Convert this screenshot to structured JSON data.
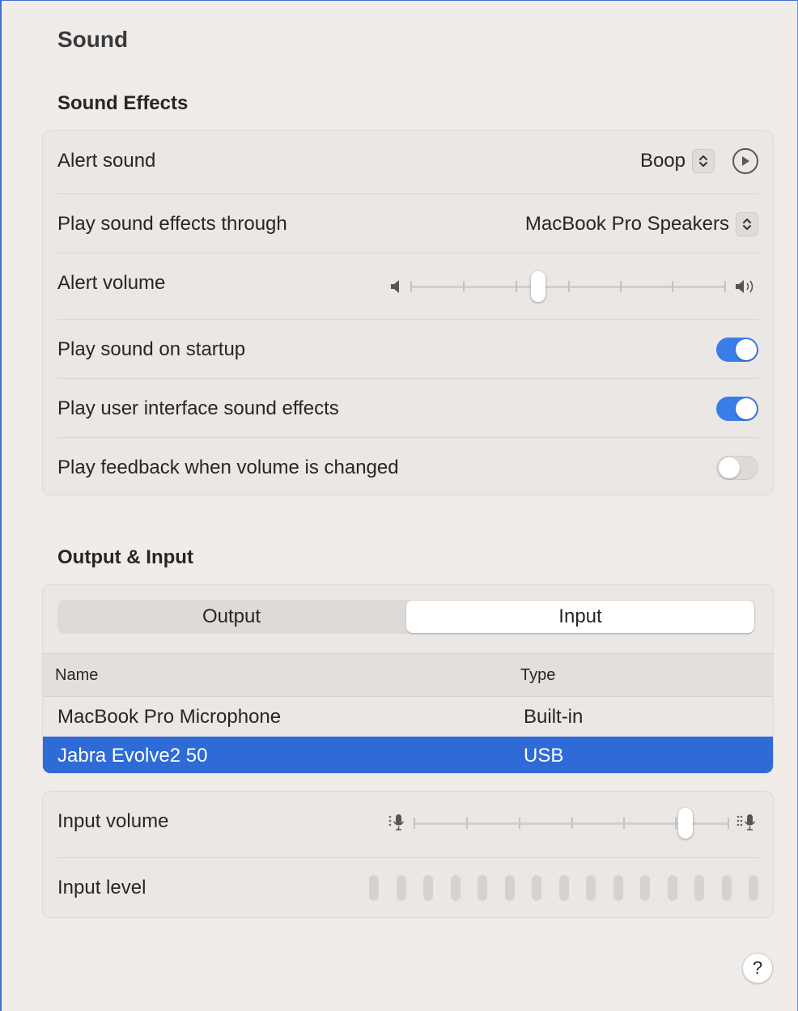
{
  "window": {
    "title": "Sound"
  },
  "sound_effects": {
    "heading": "Sound Effects",
    "alert_sound": {
      "label": "Alert sound",
      "value": "Boop"
    },
    "play_through": {
      "label": "Play sound effects through",
      "value": "MacBook Pro Speakers"
    },
    "alert_volume": {
      "label": "Alert volume",
      "level": 0.4
    },
    "startup": {
      "label": "Play sound on startup",
      "enabled": true
    },
    "ui_effects": {
      "label": "Play user interface sound effects",
      "enabled": true
    },
    "feedback": {
      "label": "Play feedback when volume is changed",
      "enabled": false
    }
  },
  "output_input": {
    "heading": "Output & Input",
    "tabs": [
      {
        "label": "Output",
        "selected": false
      },
      {
        "label": "Input",
        "selected": true
      }
    ],
    "columns": {
      "name": "Name",
      "type": "Type"
    },
    "devices": [
      {
        "name": "MacBook Pro Microphone",
        "type": "Built-in",
        "selected": false
      },
      {
        "name": "Jabra Evolve2 50",
        "type": "USB",
        "selected": true
      }
    ],
    "input_volume": {
      "label": "Input volume",
      "level": 0.88
    },
    "input_level": {
      "label": "Input level",
      "segments": 15,
      "active": 0
    }
  },
  "help": {
    "label": "?"
  },
  "colors": {
    "accent": "#3a7de8",
    "selection": "#2e6bd6",
    "background": "#f0ecea"
  },
  "icons": {
    "speaker_low": "speaker-low-icon",
    "speaker_high": "speaker-high-icon",
    "mic_low": "mic-low-icon",
    "mic_high": "mic-high-icon",
    "play": "play-icon",
    "stepper": "chevron-up-down-icon"
  }
}
